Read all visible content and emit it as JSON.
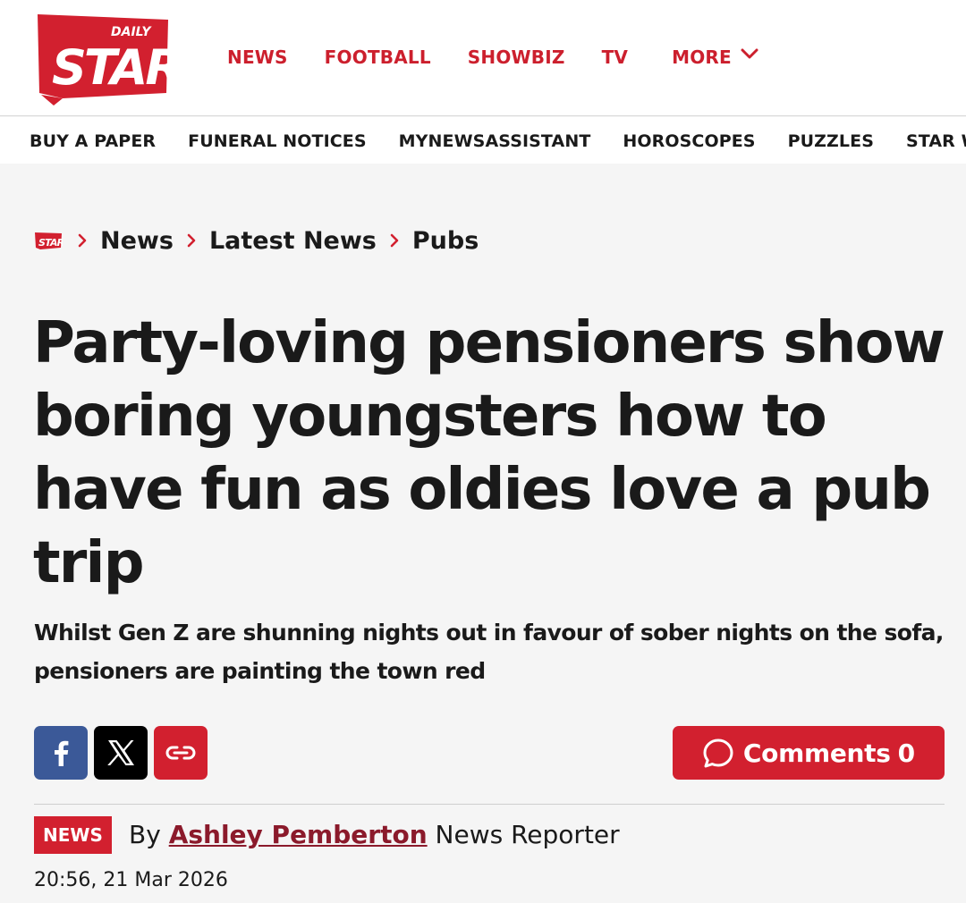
{
  "brand": {
    "logo_small_text": "DAILY",
    "logo_text": "STAR",
    "brand_red": "#d2202f"
  },
  "main_nav": {
    "items": [
      "NEWS",
      "FOOTBALL",
      "SHOWBIZ",
      "TV"
    ],
    "more_label": "MORE",
    "more_icon": "chevron-down-icon"
  },
  "sub_nav": {
    "items": [
      "BUY A PAPER",
      "FUNERAL NOTICES",
      "MYNEWSASSISTANT",
      "HOROSCOPES",
      "PUZZLES",
      "STAR W"
    ]
  },
  "breadcrumb": {
    "home_icon": "daily-star-logo-icon",
    "items": [
      "News",
      "Latest News",
      "Pubs"
    ]
  },
  "article": {
    "headline": "Party-loving pensioners show boring youngsters how to have fun as oldies love a pub trip",
    "standfirst": "Whilst Gen Z are shunning nights out in favour of sober nights on the sofa, pensioners are painting the town red",
    "section_tag": "NEWS",
    "by_prefix": "By",
    "author": "Ashley Pemberton",
    "author_role": "News Reporter",
    "timestamp": "20:56, 21 Mar 2026"
  },
  "share": {
    "facebook_icon": "facebook-icon",
    "x_icon": "x-icon",
    "link_icon": "link-icon"
  },
  "comments": {
    "label": "Comments",
    "count": "0",
    "icon": "speech-bubble-icon"
  }
}
